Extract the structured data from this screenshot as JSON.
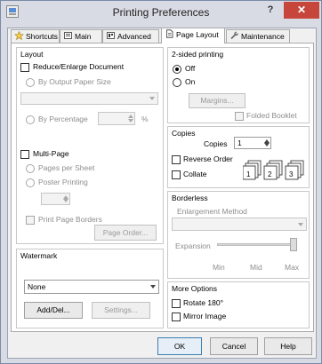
{
  "window": {
    "title": "Printing Preferences",
    "help_glyph": "?",
    "close_glyph": "✕"
  },
  "tabs": [
    {
      "label": "Shortcuts"
    },
    {
      "label": "Main"
    },
    {
      "label": "Advanced"
    },
    {
      "label": "Page Layout"
    },
    {
      "label": "Maintenance"
    }
  ],
  "layout": {
    "title": "Layout",
    "reduce_enlarge": "Reduce/Enlarge Document",
    "by_output_paper": "By Output Paper Size",
    "paper_select_value": "",
    "by_percentage": "By Percentage",
    "percentage_value": "",
    "percent_sign": "%",
    "multi_page": "Multi-Page",
    "pages_per_sheet": "Pages per Sheet",
    "poster_printing": "Poster Printing",
    "multi_select_value": "",
    "print_page_borders": "Print Page Borders",
    "page_order": "Page Order..."
  },
  "watermark": {
    "title": "Watermark",
    "value": "None",
    "add_del": "Add/Del...",
    "settings": "Settings..."
  },
  "two_sided": {
    "title": "2-sided printing",
    "off": "Off",
    "on": "On",
    "margins": "Margins...",
    "folded_booklet": "Folded Booklet"
  },
  "copies": {
    "title": "Copies",
    "label": "Copies",
    "value": "1",
    "reverse_order": "Reverse Order",
    "collate": "Collate",
    "collate_icon_labels": [
      "1",
      "2",
      "3"
    ]
  },
  "borderless": {
    "title": "Borderless",
    "enlargement_method": "Enlargement Method",
    "expansion": "Expansion",
    "slider_labels": [
      "Min",
      "Mid",
      "Max"
    ],
    "expansion_level": 1.0
  },
  "more_options": {
    "title": "More Options",
    "rotate": "Rotate 180°",
    "mirror": "Mirror Image"
  },
  "footer": {
    "ok": "OK",
    "cancel": "Cancel",
    "help": "Help"
  }
}
